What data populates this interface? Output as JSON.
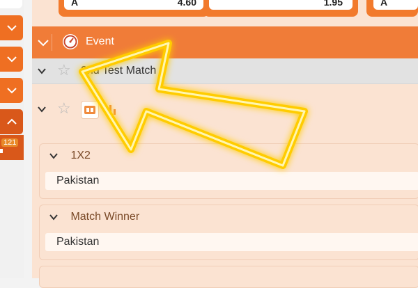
{
  "odds": {
    "left_label": "A",
    "left_value": "4.60",
    "right_value": "1.95",
    "far_label": "A"
  },
  "sidebar": {
    "badge_count": "121"
  },
  "event": {
    "title": "Event"
  },
  "match": {
    "title": "2nd Test Match"
  },
  "markets": [
    {
      "name": "1X2",
      "selection": "Pakistan"
    },
    {
      "name": "Match Winner",
      "selection": "Pakistan"
    }
  ],
  "colors": {
    "accent_orange": "#ef6f22",
    "event_bar": "#f07c38",
    "panel_bg": "#fbe3d2",
    "arrow_glow": "#ffd400"
  },
  "icons": {
    "event_icon": "gauge-icon",
    "favorite_icon": "star-icon",
    "scoreboard_icon": "scoreboard-icon",
    "stats_icon": "bar-chart-icon"
  }
}
